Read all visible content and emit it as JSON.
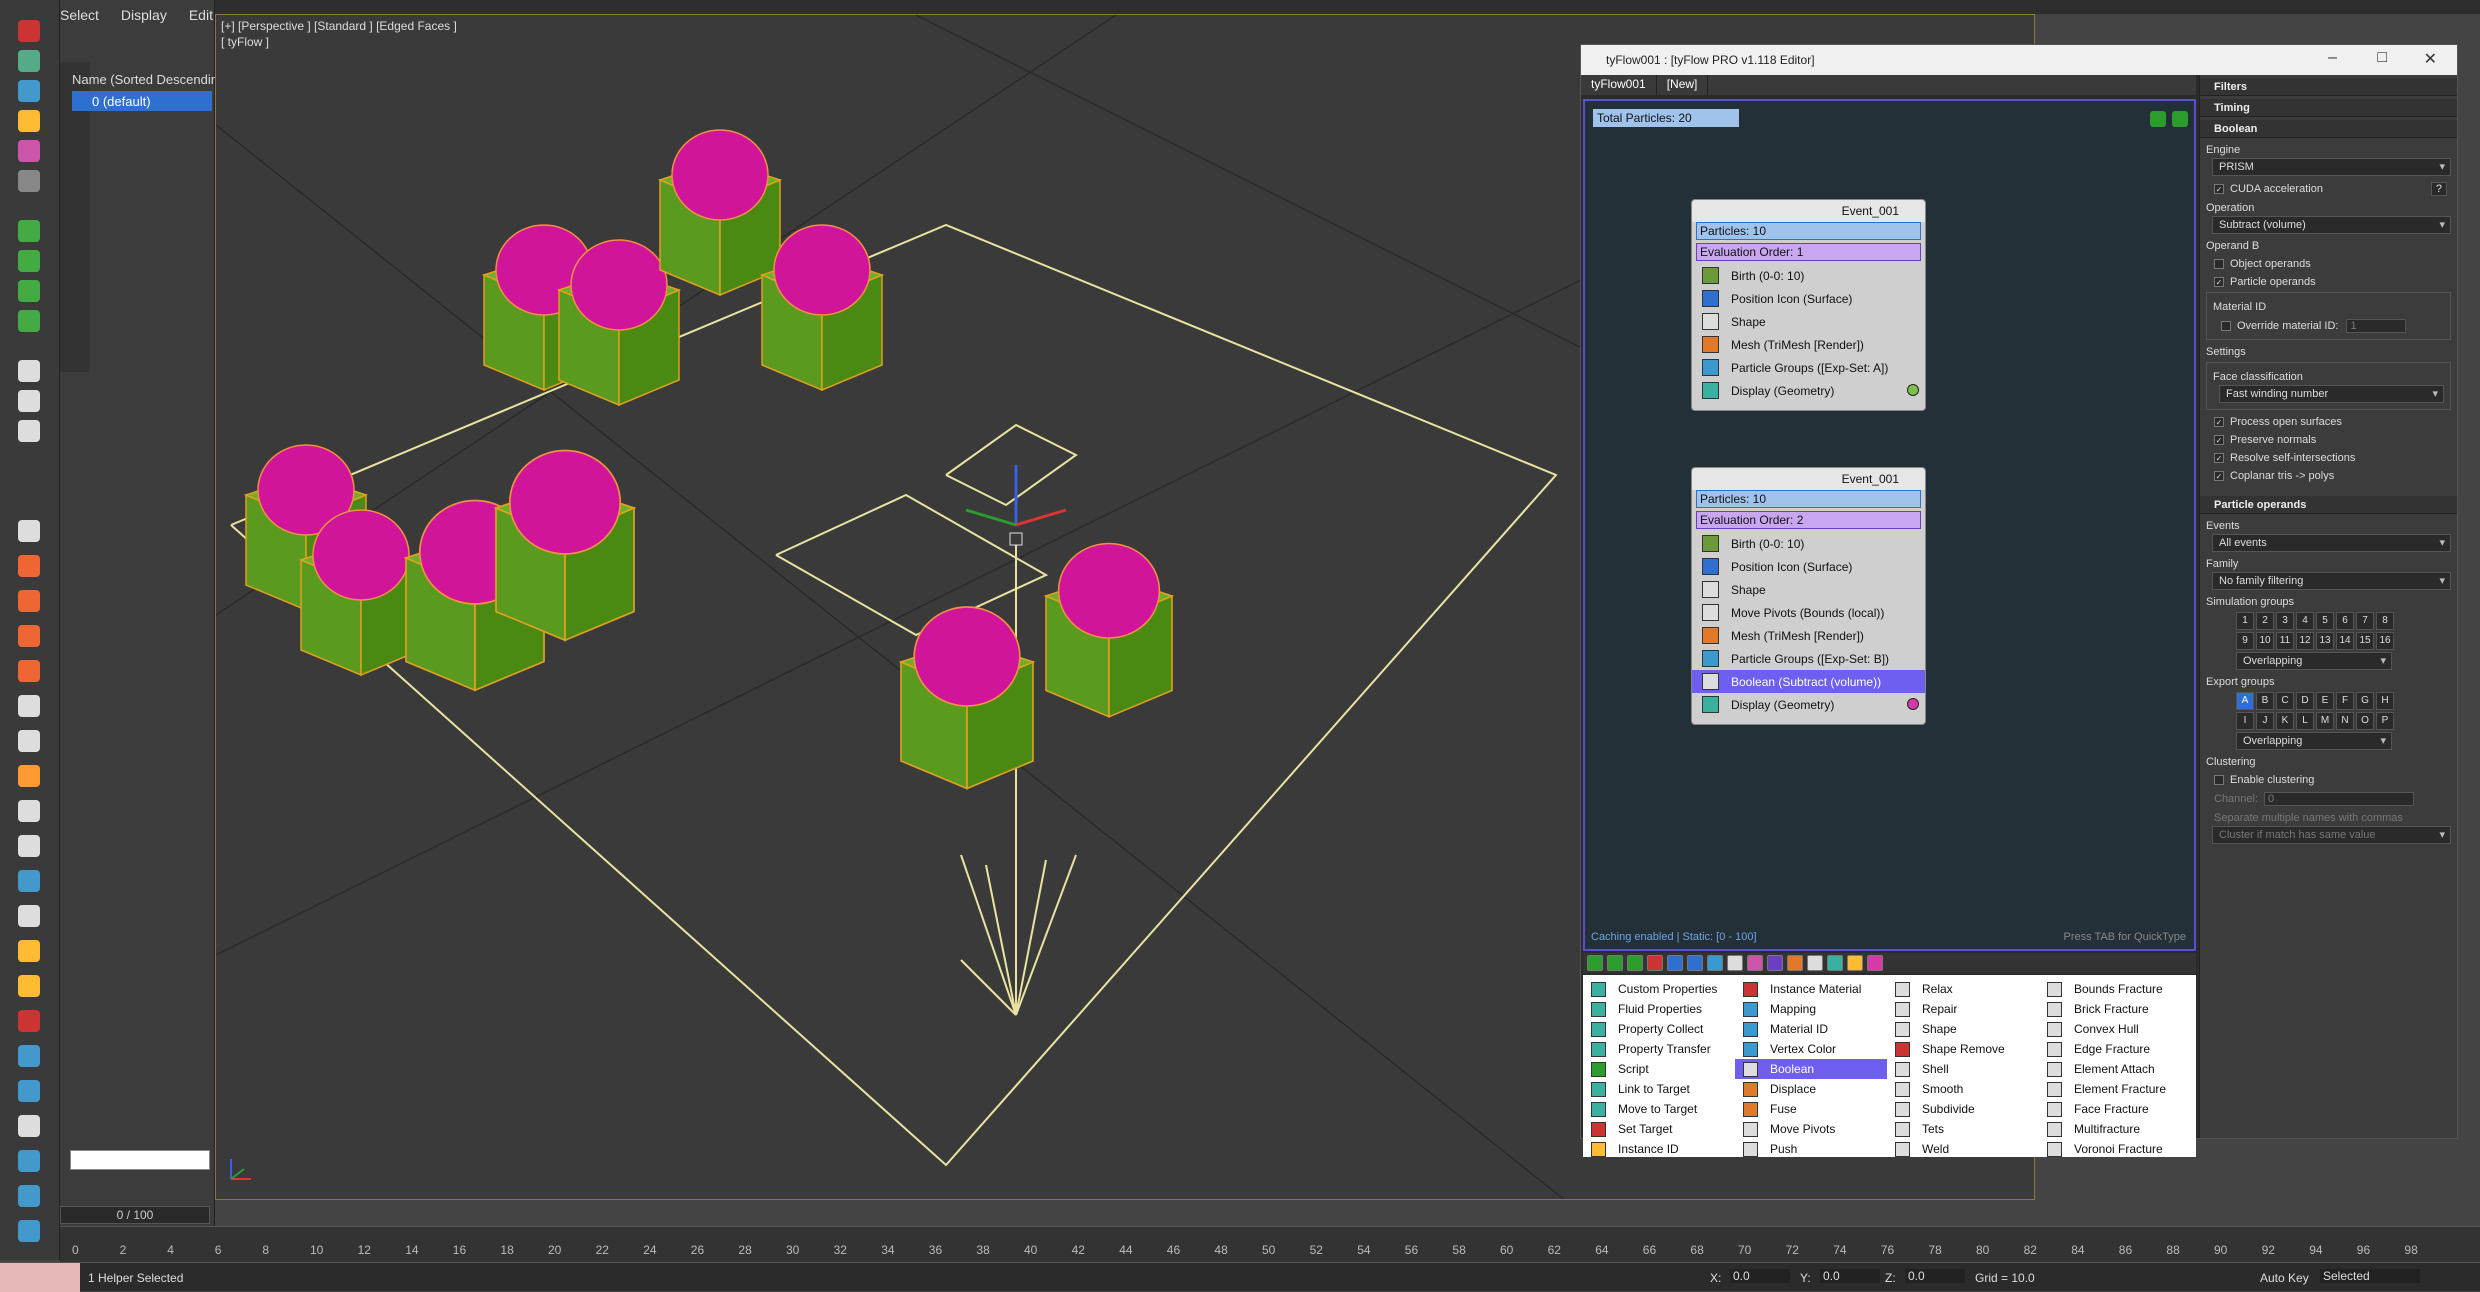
{
  "explorer": {
    "menu": [
      "Select",
      "Display",
      "Edit"
    ],
    "header": "Name (Sorted Descendin",
    "row": "0 (default)"
  },
  "viewport": {
    "label": "[+] [Perspective ] [Standard ] [Edged Faces ]",
    "sublabel": "[ tyFlow ]"
  },
  "frame_slider": "0 / 100",
  "timeline_ticks": [
    "0",
    "2",
    "4",
    "6",
    "8",
    "10",
    "12",
    "14",
    "16",
    "18",
    "20",
    "22",
    "24",
    "26",
    "28",
    "30",
    "32",
    "34",
    "36",
    "38",
    "40",
    "42",
    "44",
    "46",
    "48",
    "50",
    "52",
    "54",
    "56",
    "58",
    "60",
    "62",
    "64",
    "66",
    "68",
    "70",
    "72",
    "74",
    "76",
    "78",
    "80",
    "82",
    "84",
    "86",
    "88",
    "90",
    "92",
    "94",
    "96",
    "98"
  ],
  "status": {
    "left": "1 Helper Selected",
    "x_label": "X:",
    "x_value": "0.0",
    "y_label": "Y:",
    "y_value": "0.0",
    "z_label": "Z:",
    "z_value": "0.0",
    "grid": "Grid = 10.0",
    "autokey": "Auto Key",
    "selected": "Selected"
  },
  "tyflow": {
    "title": "tyFlow001 : [tyFlow PRO v1.118 Editor]",
    "tabs": [
      "tyFlow001",
      "[New]"
    ],
    "total_particles": "Total Particles: 20",
    "caching": "Caching enabled | Static: [0 - 100]",
    "quicktype": "Press TAB for QuickType",
    "events": [
      {
        "title": "Event_001",
        "particles": "Particles: 10",
        "order": "Evaluation Order: 1",
        "ops": [
          "Birth (0-0: 10)",
          "Position Icon (Surface)",
          "Shape",
          "Mesh (TriMesh [Render])",
          "Particle Groups ([Exp-Set: A])",
          "Display (Geometry)"
        ]
      },
      {
        "title": "Event_001",
        "particles": "Particles: 10",
        "order": "Evaluation Order: 2",
        "ops": [
          "Birth (0-0: 10)",
          "Position Icon (Surface)",
          "Shape",
          "Move Pivots (Bounds (local))",
          "Mesh (TriMesh [Render])",
          "Particle Groups ([Exp-Set: B])",
          "Boolean (Subtract (volume))",
          "Display (Geometry)"
        ]
      }
    ],
    "palette": [
      [
        "Custom Properties",
        "Fluid Properties",
        "Property Collect",
        "Property Transfer",
        "Script",
        "Link to Target",
        "Move to Target",
        "Set Target",
        "Instance ID"
      ],
      [
        "Instance Material",
        "Mapping",
        "Material ID",
        "Vertex Color",
        "Boolean",
        "Displace",
        "Fuse",
        "Move Pivots",
        "Push"
      ],
      [
        "Relax",
        "Repair",
        "Shape",
        "Shape Remove",
        "Shell",
        "Smooth",
        "Subdivide",
        "Tets",
        "Weld"
      ],
      [
        "Bounds Fracture",
        "Brick Fracture",
        "Convex Hull",
        "Edge Fracture",
        "Element Attach",
        "Element Fracture",
        "Face Fracture",
        "Multifracture",
        "Voronoi Fracture"
      ]
    ],
    "rollouts": {
      "filters": "Filters",
      "timing": "Timing",
      "boolean": "Boolean",
      "engine_label": "Engine",
      "engine_value": "PRISM",
      "cuda": "CUDA acceleration",
      "help": "?",
      "operation_label": "Operation",
      "operation_value": "Subtract (volume)",
      "operandb_label": "Operand B",
      "object_operands": "Object operands",
      "particle_operands": "Particle operands",
      "material_id_label": "Material ID",
      "override_mat": "Override material ID:",
      "override_val": "1",
      "settings_label": "Settings",
      "face_class_label": "Face classification",
      "face_class_value": "Fast winding number",
      "process_open": "Process open surfaces",
      "preserve_normals": "Preserve normals",
      "resolve_self": "Resolve self-intersections",
      "coplanar": "Coplanar tris -> polys",
      "particle_operands_sec": "Particle operands",
      "events_label": "Events",
      "events_value": "All events",
      "family_label": "Family",
      "family_value": "No family filtering",
      "simgroups_label": "Simulation groups",
      "simgroups": [
        "1",
        "2",
        "3",
        "4",
        "5",
        "6",
        "7",
        "8",
        "9",
        "10",
        "11",
        "12",
        "13",
        "14",
        "15",
        "16"
      ],
      "overlapping": "Overlapping",
      "exportgroups_label": "Export groups",
      "exportgroups": [
        "A",
        "B",
        "C",
        "D",
        "E",
        "F",
        "G",
        "H",
        "I",
        "J",
        "K",
        "L",
        "M",
        "N",
        "O",
        "P"
      ],
      "overlapping2": "Overlapping",
      "clustering_label": "Clustering",
      "enable_clustering": "Enable clustering",
      "channel": "Channel:",
      "channel_val": "0",
      "separate_note": "Separate multiple names with commas",
      "cluster_drop": "Cluster if match has same value"
    }
  }
}
